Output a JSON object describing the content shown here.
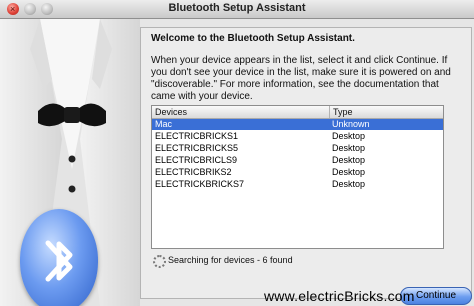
{
  "window": {
    "title": "Bluetooth Setup Assistant"
  },
  "panel": {
    "heading": "Welcome to the Bluetooth Setup Assistant.",
    "description_lines": [
      "When your device appears in the list, select it and click Continue. If",
      "you don't see your device in the list, make sure it is powered on and",
      "\"discoverable.\" For more information, see the documentation that",
      "came with your device."
    ]
  },
  "device_list": {
    "columns": [
      "Devices",
      "Type"
    ],
    "rows": [
      {
        "device": "Mac",
        "type": "Unknown",
        "selected": true
      },
      {
        "device": "ELECTRICBRICKS1",
        "type": "Desktop",
        "selected": false
      },
      {
        "device": "ELECTRICBRICKS5",
        "type": "Desktop",
        "selected": false
      },
      {
        "device": "ELECTRICBRICLS9",
        "type": "Desktop",
        "selected": false
      },
      {
        "device": "ELECTRICBRIKS2",
        "type": "Desktop",
        "selected": false
      },
      {
        "device": "ELECTRICKBRICKS7",
        "type": "Desktop",
        "selected": false
      }
    ]
  },
  "status": {
    "text": "Searching for devices - 6 found"
  },
  "buttons": {
    "continue_label": "Continue"
  },
  "watermark": "www.electricBricks.com",
  "icons": [
    "close-icon",
    "bluetooth-icon",
    "spinner-icon",
    "tuxedo-illustration"
  ],
  "colors": {
    "selection": "#3a6fd6",
    "button_blue": "#6d9ef0",
    "bluetooth_blue": "#2c5fc8"
  }
}
